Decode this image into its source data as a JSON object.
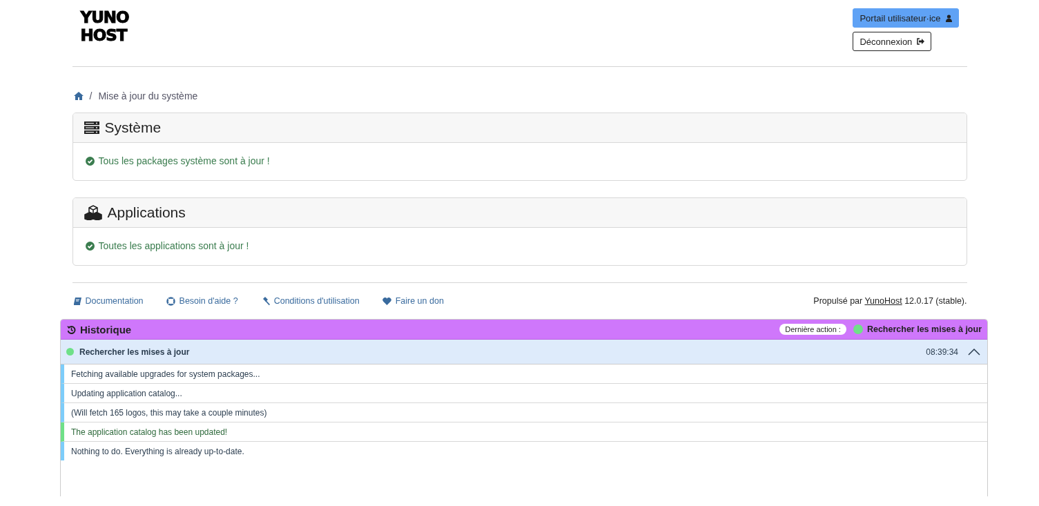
{
  "logo": {
    "lines": [
      "YUNO",
      "HOST"
    ]
  },
  "header_buttons": [
    {
      "kind": "primary",
      "label": "Portail utilisateur·ice"
    },
    {
      "kind": "outline",
      "label": "Déconnexion"
    }
  ],
  "breadcrumb": {
    "separator": "/",
    "items": [
      "Mise à jour du système"
    ]
  },
  "cards": [
    {
      "kind": "system",
      "title": "Système",
      "message": "Tous les packages système sont à jour !"
    },
    {
      "kind": "apps",
      "title": "Applications",
      "message": "Toutes les applications sont à jour !"
    }
  ],
  "footer": {
    "links": [
      {
        "kind": "book",
        "label": "Documentation"
      },
      {
        "kind": "lifebuoy",
        "label": "Besoin d'aide ?"
      },
      {
        "kind": "gavel",
        "label": "Conditions d'utilisation"
      },
      {
        "kind": "heart",
        "label": "Faire un don"
      }
    ],
    "powered_prefix": "Propulsé par",
    "powered_link": "YunoHost",
    "powered_suffix": "12.0.17 (stable)."
  },
  "history": {
    "title": "Historique",
    "last_action_label": "Dernière action :",
    "last_action": {
      "title": "Rechercher les mises à jour",
      "color": "#6fe088"
    },
    "entries": [
      {
        "title": "Rechercher les mises à jour",
        "color": "#6fe088",
        "time": "08:39:34",
        "expanded": true,
        "lines": [
          {
            "kind": "info",
            "text": "Fetching available upgrades for system packages..."
          },
          {
            "kind": "info",
            "text": "Updating application catalog..."
          },
          {
            "kind": "info",
            "text": "(Will fetch 165 logos, this may take a couple minutes)"
          },
          {
            "kind": "success",
            "text": "The application catalog has been updated!"
          },
          {
            "kind": "info",
            "text": "Nothing to do. Everything is already up-to-date."
          }
        ]
      }
    ]
  }
}
